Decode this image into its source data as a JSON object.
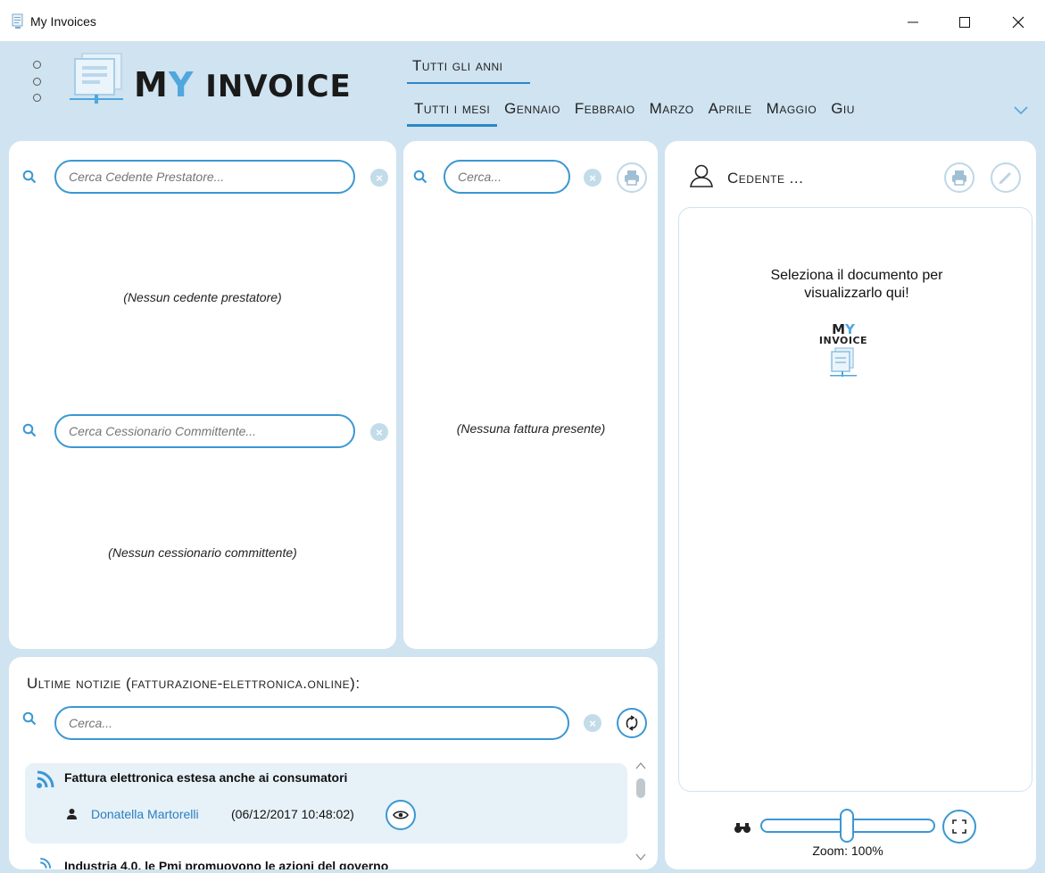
{
  "window": {
    "title": "My Invoices",
    "icon": "invoice-app-icon",
    "controls": [
      "minimize-icon",
      "maximize-icon",
      "close-icon"
    ]
  },
  "header": {
    "logo": {
      "prefix": "M",
      "y": "Y",
      "suffix": " INVOICE"
    },
    "year_tab": "Tutti gli anni",
    "months": [
      "Tutti i mesi",
      "Gennaio",
      "Febbraio",
      "Marzo",
      "Aprile",
      "Maggio",
      "Giu"
    ],
    "active_month_index": 0,
    "more_months_icon": "chevron-down-icon"
  },
  "left_panel": {
    "cedente_search": {
      "placeholder": "Cerca Cedente Prestatore...",
      "value": ""
    },
    "cedente_empty": "(Nessun cedente prestatore)",
    "cessionario_search": {
      "placeholder": "Cerca Cessionario Committente...",
      "value": ""
    },
    "cessionario_empty": "(Nessun cessionario committente)"
  },
  "middle_panel": {
    "search": {
      "placeholder": "Cerca...",
      "value": ""
    },
    "empty": "(Nessuna fattura presente)"
  },
  "right_panel": {
    "label": "Cedente ...",
    "viewer_message_line1": "Seleziona il documento per",
    "viewer_message_line2": "visualizzarlo qui!",
    "mini_logo": {
      "my_m": "M",
      "my_y": "Y",
      "invoice": "INVOICE"
    },
    "zoom": {
      "label": "Zoom: 100%",
      "value_percent": 100
    }
  },
  "news": {
    "heading": "Ultime notizie (fatturazione-elettronica.online):",
    "search": {
      "placeholder": "Cerca...",
      "value": ""
    },
    "items": [
      {
        "title": "Fattura elettronica estesa anche ai consumatori",
        "author": "Donatella Martorelli",
        "date": "(06/12/2017 10:48:02)"
      },
      {
        "title": "Industria 4.0, le Pmi promuovono le azioni del governo",
        "author": "",
        "date": ""
      }
    ]
  },
  "colors": {
    "accent": "#3b97d3",
    "background": "#cfe3f0",
    "link": "#2b7fc0",
    "news_card": "#e7f1f8"
  }
}
